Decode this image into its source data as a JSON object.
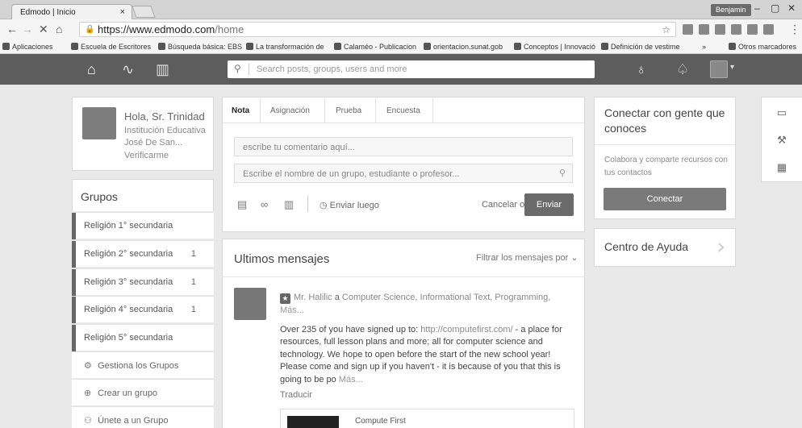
{
  "browser": {
    "tab_title": "Edmodo | Inicio",
    "tab_close": "×",
    "user_chip": "Benjamin",
    "window_controls": [
      "–",
      "▢",
      "✕"
    ],
    "url_host": "https://www.edmodo.com",
    "url_path": "/home",
    "bookmarks": [
      "Aplicaciones",
      "Escuela de Escritores",
      "Búsqueda básica: EBS",
      "La transformación de",
      "Calaméo - Publicacion",
      "orientacion.sunat.gob",
      "Conceptos | Innovació",
      "Definición de vestime"
    ],
    "bookmarks_more": "»",
    "bookmarks_other": "Otros marcadores"
  },
  "topnav": {
    "search_placeholder": "Search posts, groups, users and more"
  },
  "profile": {
    "greeting": "Hola, Sr. Trinidad",
    "institution_line1": "Institución Educativa",
    "institution_line2": "José De San...",
    "verify": "Verificarme"
  },
  "groups": {
    "title": "Grupos",
    "items": [
      {
        "label": "Religión 1° secundaria",
        "count": ""
      },
      {
        "label": "Religión 2° secundaria",
        "count": "1"
      },
      {
        "label": "Religión 3° secundaria",
        "count": "1"
      },
      {
        "label": "Religión 4° secundaria",
        "count": "1"
      },
      {
        "label": "Religión 5° secundaria",
        "count": ""
      }
    ],
    "manage": "Gestiona los Grupos",
    "create": "Crear un grupo",
    "join": "Únete a un Grupo"
  },
  "composer": {
    "tabs": [
      "Nota",
      "Asignación",
      "Prueba",
      "Encuesta"
    ],
    "comment_placeholder": "escribe tu comentario aquí...",
    "recipient_placeholder": "Escribe el nombre de un grupo, estudiante o profesor...",
    "send_later": "Enviar luego",
    "cancel": "Cancelar o",
    "send": "Enviar"
  },
  "feed": {
    "title": "Ultimos mensajes",
    "filter": "Filtrar los mensajes por",
    "post": {
      "author": "Mr. Halilic",
      "connector": "a",
      "targets": "Computer Science, Informational Text, Programming,",
      "more_targets": "Más...",
      "body_before_link": "Over 235 of you have signed up to: ",
      "link": "http://computefirst.com/",
      "body_after_link": " - a place for resources, full lesson plans and more; all for computer science and technology. We hope to open before the start of the new school year! Please come and sign up if you haven't - it is because of you that this is going to be po",
      "more": "Más...",
      "translate": "Traducir",
      "attachment_title": "Compute First"
    }
  },
  "sidebar": {
    "connect_title": "Conectar con gente que conoces",
    "connect_text": "Colabora y comparte recursos con tus contactos",
    "connect_button": "Conectar",
    "help_title": "Centro de Ayuda"
  }
}
